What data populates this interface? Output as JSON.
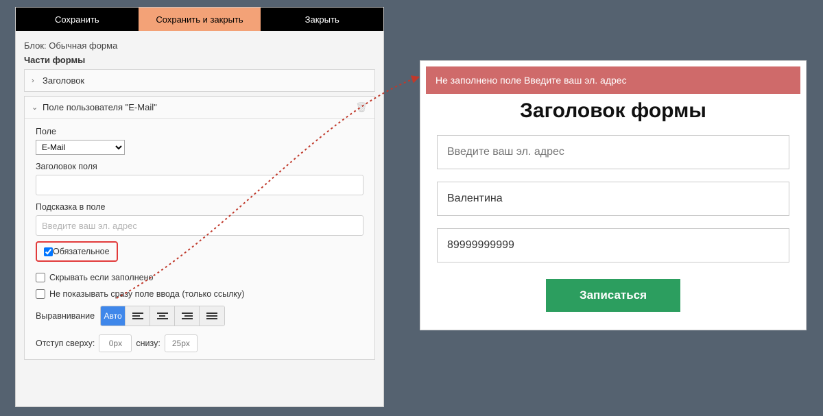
{
  "editor": {
    "tabs": {
      "save": "Сохранить",
      "save_close": "Сохранить и закрыть",
      "close": "Закрыть"
    },
    "block_title": "Блок: Обычная форма",
    "parts_title": "Части формы",
    "accordion": {
      "item1": "Заголовок",
      "item2": "Поле пользователя \"E-Mail\""
    },
    "field_section": {
      "field_label": "Поле",
      "field_select_value": "E-Mail",
      "field_title_label": "Заголовок поля",
      "field_title_value": "",
      "placeholder_label": "Подсказка в поле",
      "placeholder_value": "Введите ваш эл. адрес",
      "required_label": "Обязательное",
      "hide_when_filled": "Скрывать если заполнено",
      "hide_input_link_only": "Не показывать сразу поле ввода (только ссылку)",
      "align_label": "Выравнивание",
      "align_auto": "Авто",
      "margin_top_label": "Отступ сверху:",
      "margin_top_value": "0px",
      "margin_bottom_label": "снизу:",
      "margin_bottom_value": "25px"
    }
  },
  "preview": {
    "error_text": "Не заполнено поле Введите ваш эл. адрес",
    "title": "Заголовок формы",
    "email_placeholder": "Введите ваш эл. адрес",
    "name_value": "Валентина",
    "phone_value": "89999999999",
    "submit": "Записаться"
  }
}
